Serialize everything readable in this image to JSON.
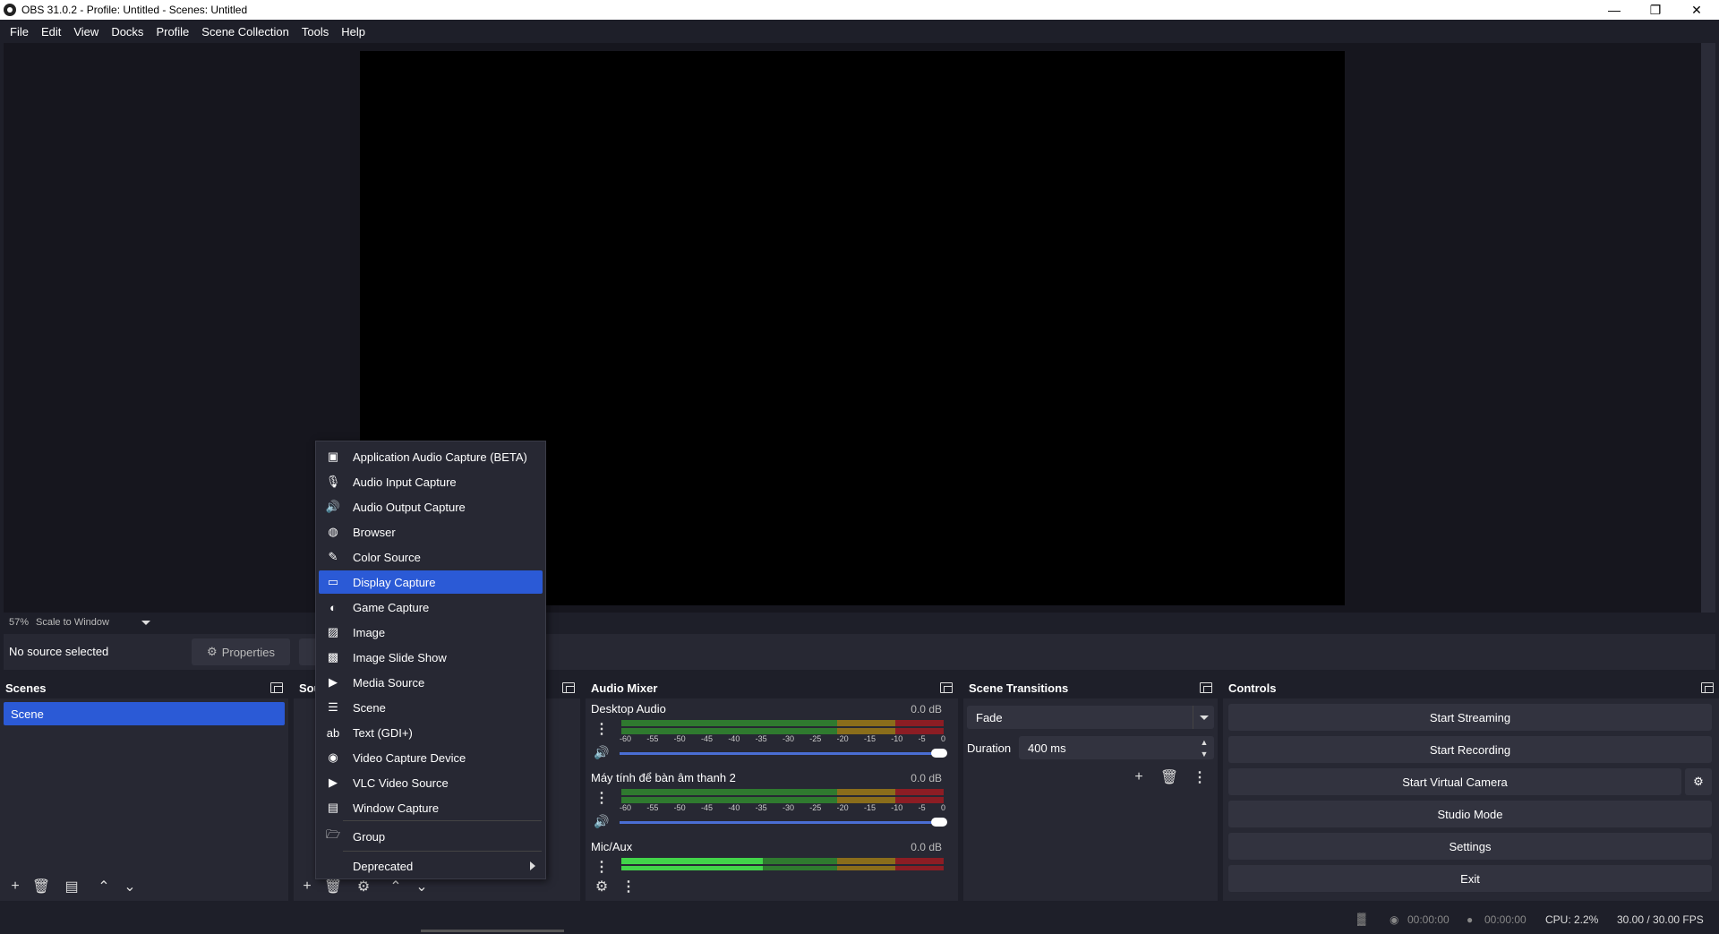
{
  "window": {
    "title": "OBS 31.0.2 - Profile: Untitled - Scenes: Untitled"
  },
  "menubar": [
    "File",
    "Edit",
    "View",
    "Docks",
    "Profile",
    "Scene Collection",
    "Tools",
    "Help"
  ],
  "zoom": {
    "percent": "57%",
    "mode": "Scale to Window"
  },
  "context": {
    "no_source": "No source selected",
    "properties": "Properties"
  },
  "scenes": {
    "title": "Scenes",
    "items": [
      "Scene"
    ]
  },
  "sources": {
    "title": "Sou"
  },
  "mixer": {
    "title": "Audio Mixer",
    "ticks": [
      "-60",
      "-55",
      "-50",
      "-45",
      "-40",
      "-35",
      "-30",
      "-25",
      "-20",
      "-15",
      "-10",
      "-5",
      "0"
    ],
    "channels": [
      {
        "name": "Desktop Audio",
        "db": "0.0 dB",
        "level": 0.0
      },
      {
        "name": "Máy tính để bàn âm thanh 2",
        "db": "0.0 dB",
        "level": 0.0
      },
      {
        "name": "Mic/Aux",
        "db": "0.0 dB",
        "level": 0.44
      }
    ]
  },
  "transitions": {
    "title": "Scene Transitions",
    "selected": "Fade",
    "duration_label": "Duration",
    "duration_value": "400 ms"
  },
  "controls": {
    "title": "Controls",
    "buttons": [
      "Start Streaming",
      "Start Recording",
      "Start Virtual Camera",
      "Studio Mode",
      "Settings",
      "Exit"
    ]
  },
  "status": {
    "stream_time": "00:00:00",
    "record_time": "00:00:00",
    "cpu": "CPU: 2.2%",
    "fps": "30.00 / 30.00 FPS"
  },
  "context_menu": {
    "items": [
      {
        "label": "Application Audio Capture (BETA)",
        "icon": "app-audio-icon"
      },
      {
        "label": "Audio Input Capture",
        "icon": "microphone-icon"
      },
      {
        "label": "Audio Output Capture",
        "icon": "speaker-icon"
      },
      {
        "label": "Browser",
        "icon": "globe-icon"
      },
      {
        "label": "Color Source",
        "icon": "brush-icon"
      },
      {
        "label": "Display Capture",
        "icon": "monitor-icon",
        "selected": true
      },
      {
        "label": "Game Capture",
        "icon": "gamepad-icon"
      },
      {
        "label": "Image",
        "icon": "image-icon"
      },
      {
        "label": "Image Slide Show",
        "icon": "slideshow-icon"
      },
      {
        "label": "Media Source",
        "icon": "play-icon"
      },
      {
        "label": "Scene",
        "icon": "list-icon"
      },
      {
        "label": "Text (GDI+)",
        "icon": "text-icon"
      },
      {
        "label": "Video Capture Device",
        "icon": "camera-icon"
      },
      {
        "label": "VLC Video Source",
        "icon": "play-icon"
      },
      {
        "label": "Window Capture",
        "icon": "window-icon"
      }
    ],
    "group": {
      "label": "Group",
      "icon": "folder-icon"
    },
    "deprecated": {
      "label": "Deprecated"
    }
  },
  "colors": {
    "accent": "#2b5ad6",
    "panel": "#272833",
    "background": "#1e1f29"
  }
}
